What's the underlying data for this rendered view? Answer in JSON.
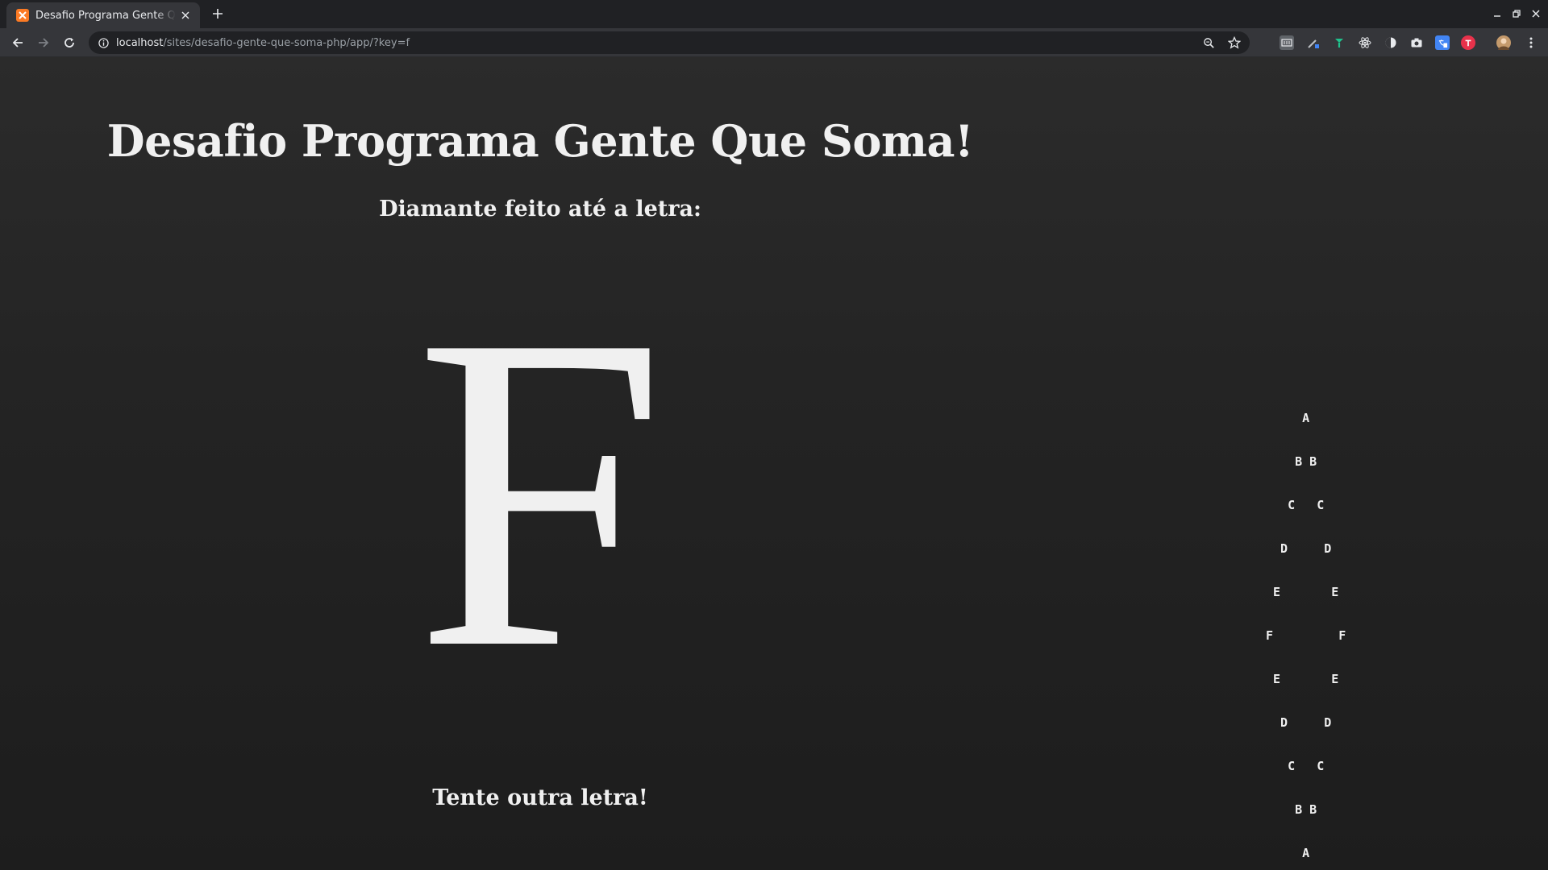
{
  "browser": {
    "tab": {
      "title": "Desafio Programa Gente Que Soma!"
    },
    "address": {
      "host": "localhost",
      "path": "/sites/desafio-gente-que-soma-php/app/?key=f"
    }
  },
  "page": {
    "title": "Desafio Programa Gente Que Soma!",
    "subtitle": "Diamante feito até a letra:",
    "letter": "F",
    "diamond_rows": [
      "     A",
      "    B B",
      "   C   C",
      "  D     D",
      " E       E",
      "F         F",
      " E       E",
      "  D     D",
      "   C   C",
      "    B B",
      "     A"
    ],
    "retry_link": "Tente outra letra!"
  }
}
